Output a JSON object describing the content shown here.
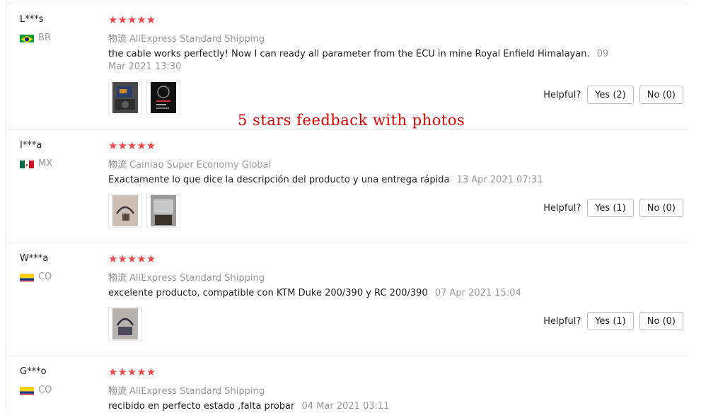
{
  "overlay_caption": "5 stars feedback with photos",
  "reviews": [
    {
      "user": "L***s",
      "country": "BR",
      "flag_colors": [
        "#009c3b",
        "#ffdf00",
        "#002776"
      ],
      "stars": "★★★★★",
      "rating": 5,
      "shipping_label": "物流",
      "shipping": "AliExpress Standard Shipping",
      "text": "the cable works perfectly! Now I can ready all parameter from the ECU in mine Royal Enfield Himalayan.",
      "date": "09 Mar 2021 13:30",
      "photos": [
        "photo-1",
        "photo-2"
      ],
      "helpful_label": "Helpful?",
      "yes": "Yes (2)",
      "no": "No (0)"
    },
    {
      "user": "I***a",
      "country": "MX",
      "flag_colors": [
        "#006847",
        "#ffffff",
        "#ce1126"
      ],
      "stars": "★★★★★",
      "rating": 5,
      "shipping_label": "物流",
      "shipping": "Cainiao Super Economy Global",
      "text": "Exactamente lo que dice la descripción del producto y una entrega rápida",
      "date": "13 Apr 2021 07:31",
      "photos": [
        "photo-1",
        "photo-2"
      ],
      "helpful_label": "Helpful?",
      "yes": "Yes (1)",
      "no": "No (0)"
    },
    {
      "user": "W***a",
      "country": "CO",
      "flag_colors": [
        "#fcd116",
        "#003893",
        "#ce1126"
      ],
      "stars": "★★★★★",
      "rating": 5,
      "shipping_label": "物流",
      "shipping": "AliExpress Standard Shipping",
      "text": "excelente producto, compatible con KTM Duke 200/390 y RC 200/390",
      "date": "07 Apr 2021 15:04",
      "photos": [
        "photo-1"
      ],
      "helpful_label": "Helpful?",
      "yes": "Yes (1)",
      "no": "No (0)"
    },
    {
      "user": "G***o",
      "country": "CO",
      "flag_colors": [
        "#fcd116",
        "#003893",
        "#ce1126"
      ],
      "stars": "★★★★★",
      "rating": 5,
      "shipping_label": "物流",
      "shipping": "AliExpress Standard Shipping",
      "text": "recibido en perfecto estado ,falta probar",
      "date": "04 Mar 2021 03:11"
    }
  ]
}
